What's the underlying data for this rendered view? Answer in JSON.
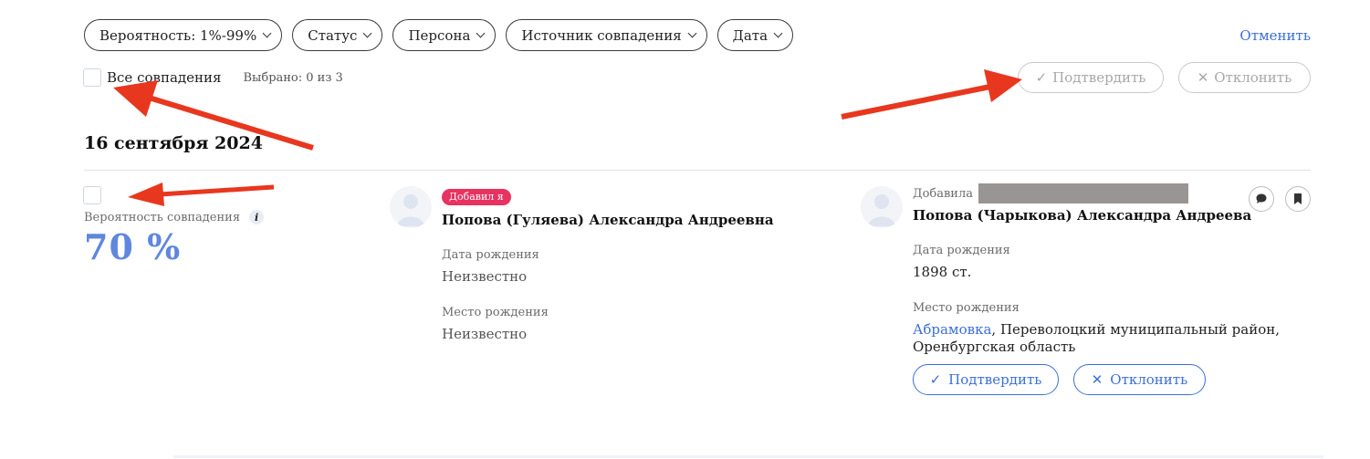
{
  "filters": [
    {
      "label": "Вероятность: 1%-99%"
    },
    {
      "label": "Статус"
    },
    {
      "label": "Персона"
    },
    {
      "label": "Источник совпадения"
    },
    {
      "label": "Дата"
    }
  ],
  "cancel_label": "Отменить",
  "selection": {
    "all_label": "Все совпадения",
    "selected_text": "Выбрано: 0 из 3"
  },
  "bulk_actions": {
    "confirm_label": "Подтвердить",
    "reject_label": "Отклонить"
  },
  "date_heading": "16 сентября 2024",
  "match": {
    "probability_label": "Вероятность совпадения",
    "probability_value": "70 %",
    "left_person": {
      "badge": "Добавил я",
      "name": "Попова (Гуляева) Александра Андреевна",
      "birth_date_label": "Дата рождения",
      "birth_date": "Неизвестно",
      "birth_place_label": "Место рождения",
      "birth_place": "Неизвестно"
    },
    "right_person": {
      "added_by_label": "Добавила",
      "name": "Попова (Чарыкова) Александра Андреева",
      "birth_date_label": "Дата рождения",
      "birth_date": "1898 ст.",
      "birth_place_label": "Место рождения",
      "birth_place_link": "Абрамовка",
      "birth_place_rest": ", Переволоцкий муниципальный район,",
      "birth_place_line2": "Оренбургская область"
    },
    "confirm_label": "Подтвердить",
    "reject_label": "Отклонить"
  },
  "colors": {
    "accent": "#3b6fd6",
    "probability": "#5f87de",
    "badge": "#e8325f",
    "annotation_arrow": "#e8371f"
  }
}
